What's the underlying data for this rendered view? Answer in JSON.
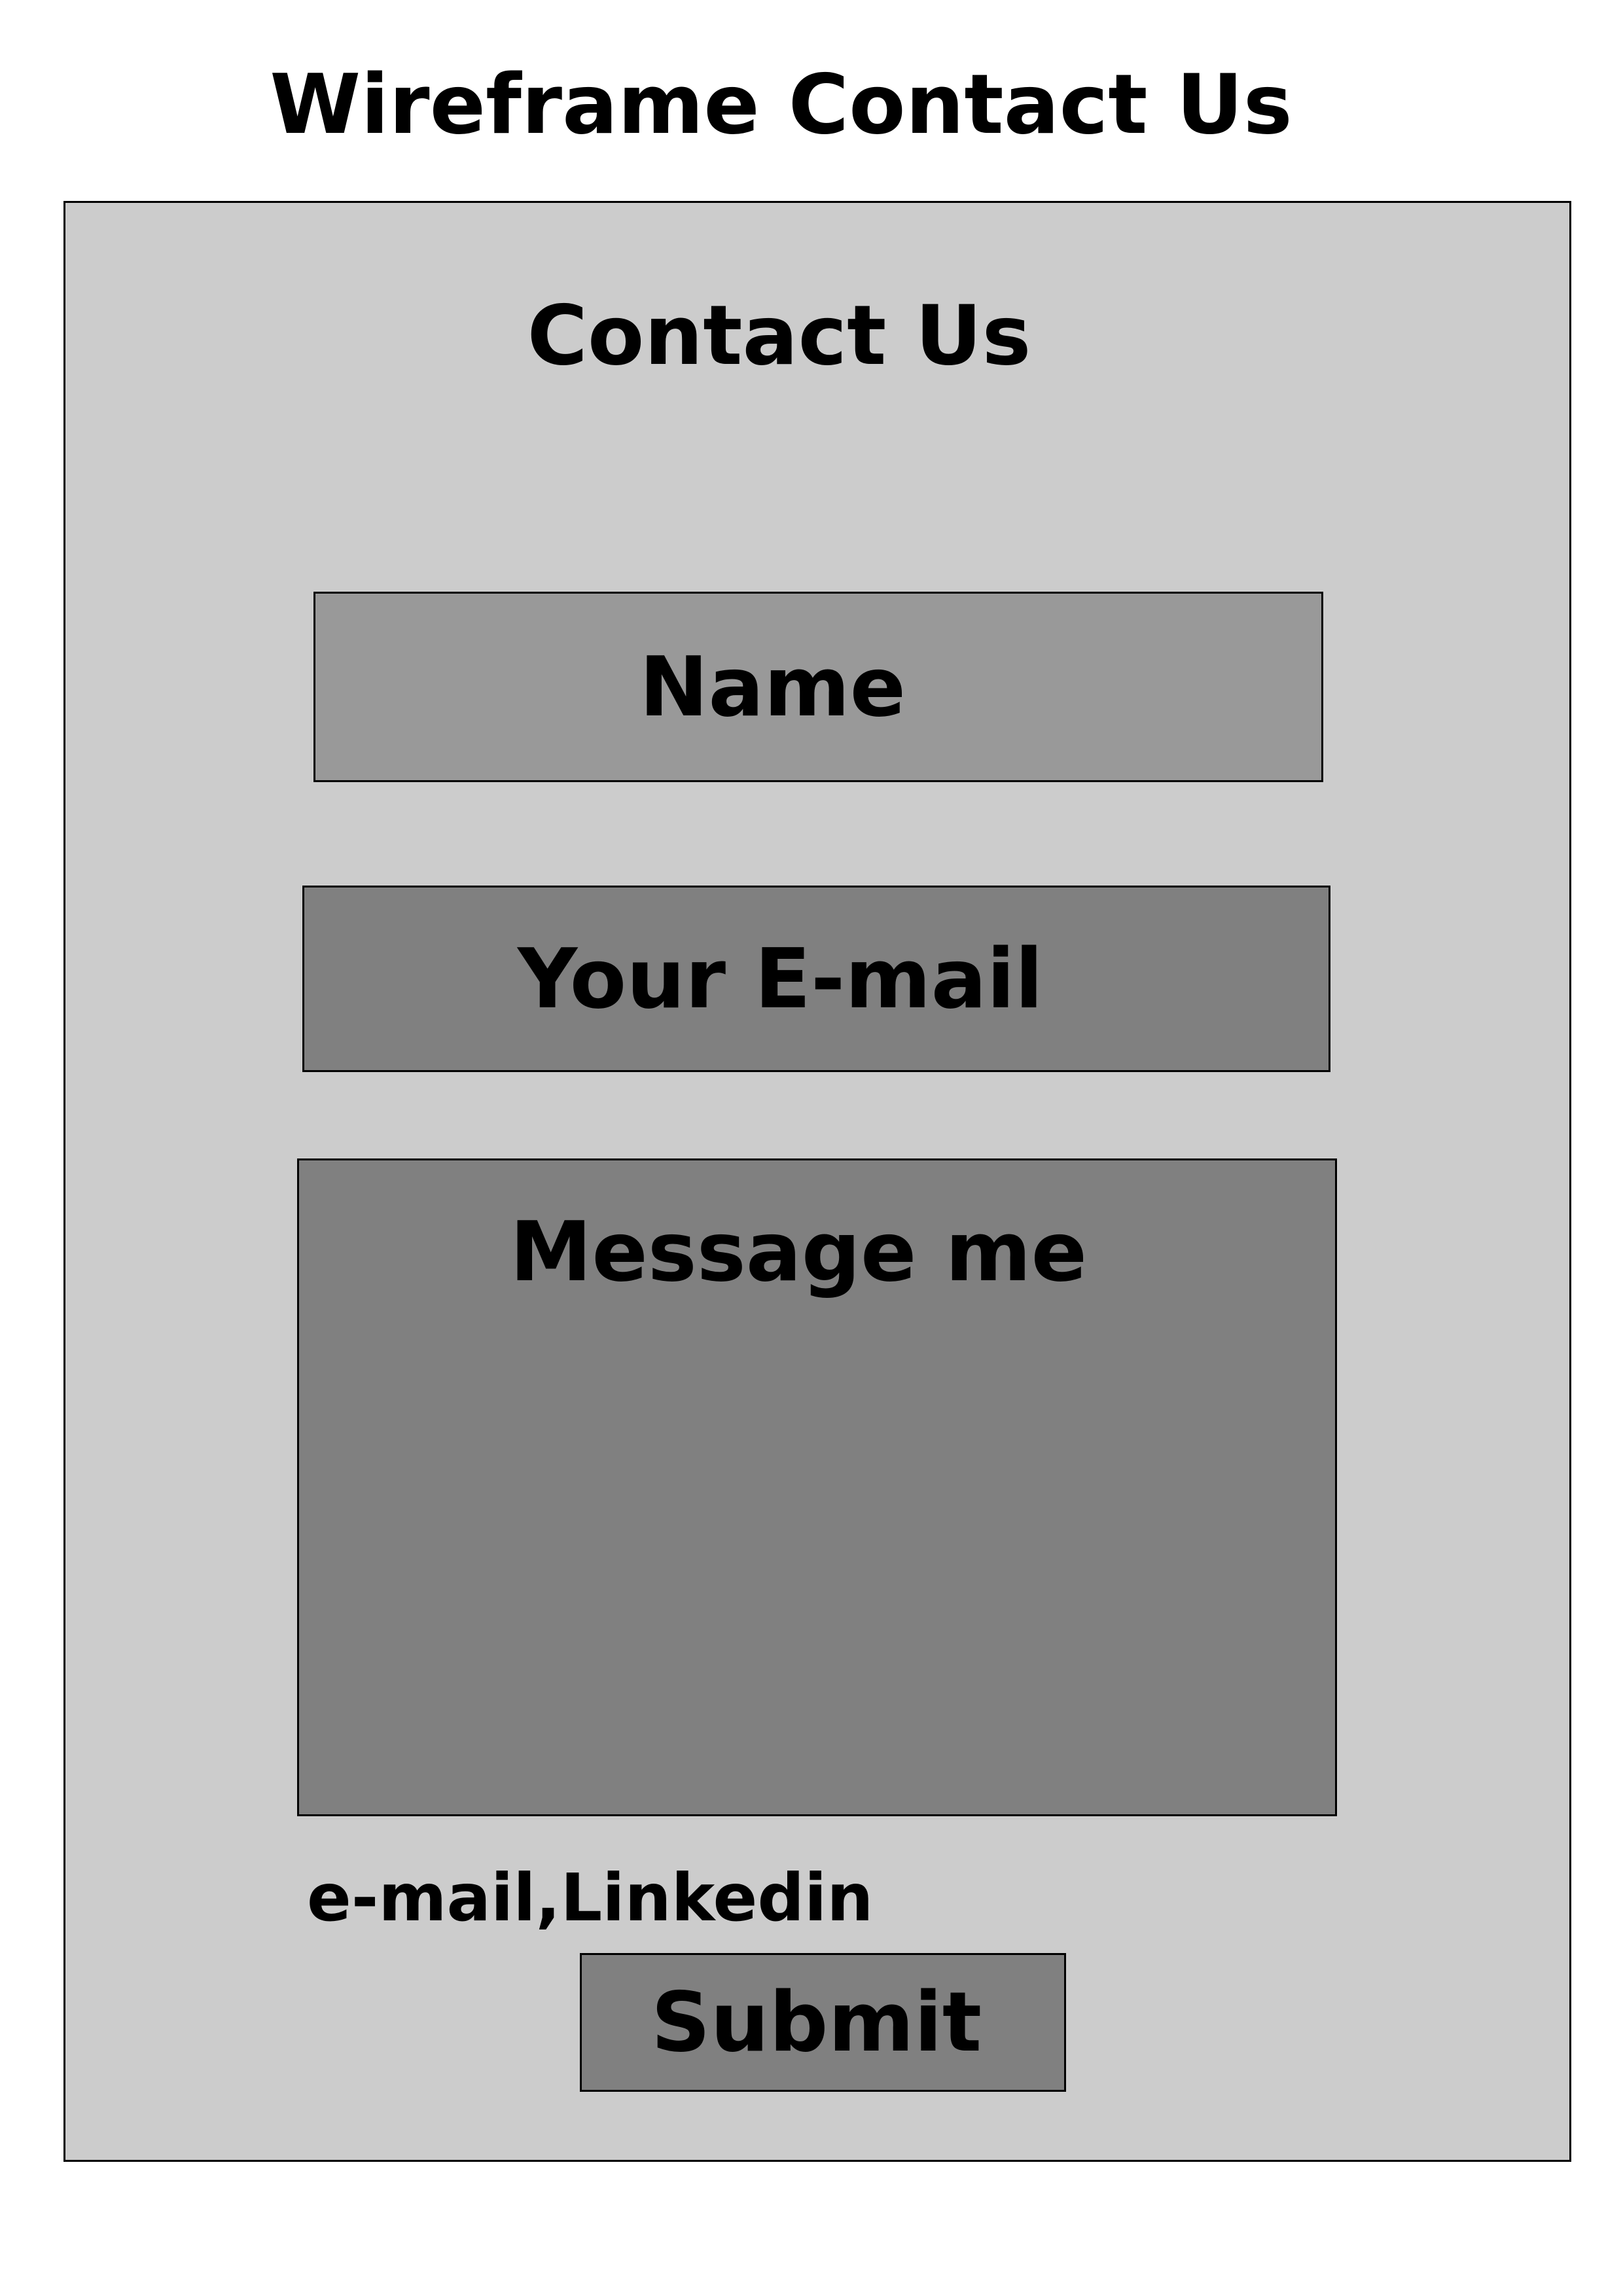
{
  "page": {
    "title": "Wireframe Contact Us"
  },
  "form": {
    "heading": "Contact Us",
    "name_label": "Name",
    "email_label": "Your E-mail",
    "message_label": "Message me",
    "links_text": "e-mail,Linkedin",
    "submit_label": "Submit"
  },
  "colors": {
    "page_background": "#ffffff",
    "frame_background": "#cccccc",
    "name_field": "#999999",
    "email_field": "#808080",
    "message_field": "#808080",
    "submit_button": "#808080",
    "border": "#000000"
  }
}
